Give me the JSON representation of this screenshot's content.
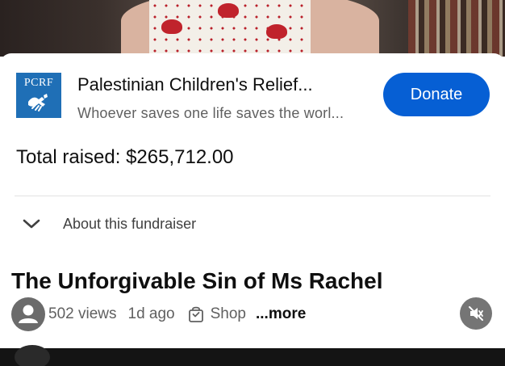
{
  "fundraiser": {
    "org_logo_text": "PCRF",
    "org_name": "Palestinian Children's Relief...",
    "tagline": "Whoever saves one life saves the worl...",
    "donate_label": "Donate",
    "total_raised": "Total raised: $265,712.00",
    "about_label": "About this fundraiser"
  },
  "video": {
    "title": "The Unforgivable Sin of Ms Rachel",
    "views": "502 views",
    "age": "1d ago",
    "shop_label": "Shop",
    "more_label": "...more"
  },
  "icons": {
    "logo": "pcrf-hands-logo-icon",
    "about_toggle": "chevron-down-icon",
    "avatar": "person-avatar-icon",
    "shop": "shopping-bag-icon",
    "mute": "volume-muted-icon"
  },
  "colors": {
    "accent": "#065fd4",
    "logo_bg": "#1f6fb6",
    "secondary_text": "#606060",
    "mute_bg": "#757575"
  }
}
